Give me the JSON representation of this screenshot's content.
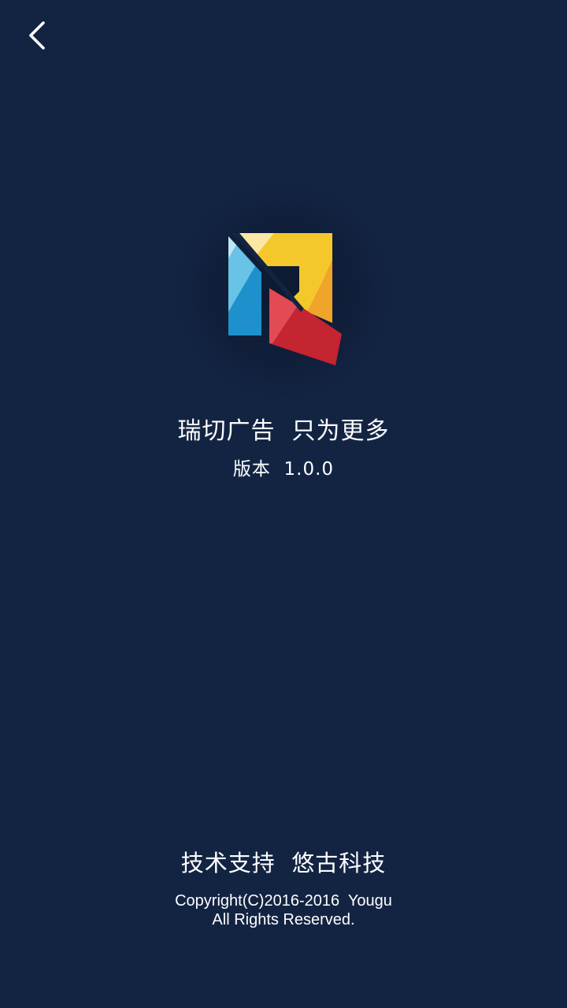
{
  "header": {
    "back_icon": "chevron-left-icon"
  },
  "logo": {
    "icon": "ruiqie-logo",
    "colors": {
      "blue": "#1E91CD",
      "light_blue": "#68C3E6",
      "yellow": "#F4C82B",
      "light_yellow": "#FAE7A3",
      "orange": "#EFA42A",
      "red": "#C52431",
      "light_red": "#E24B55",
      "background": "#132443"
    }
  },
  "about": {
    "slogan": "瑞切广告  只为更多",
    "version": "版本  1.0.0"
  },
  "footer": {
    "support": "技术支持  悠古科技",
    "copyright_line1": "Copyright(C)2016-2016  Yougu",
    "copyright_line2": "All Rights Reserved."
  }
}
